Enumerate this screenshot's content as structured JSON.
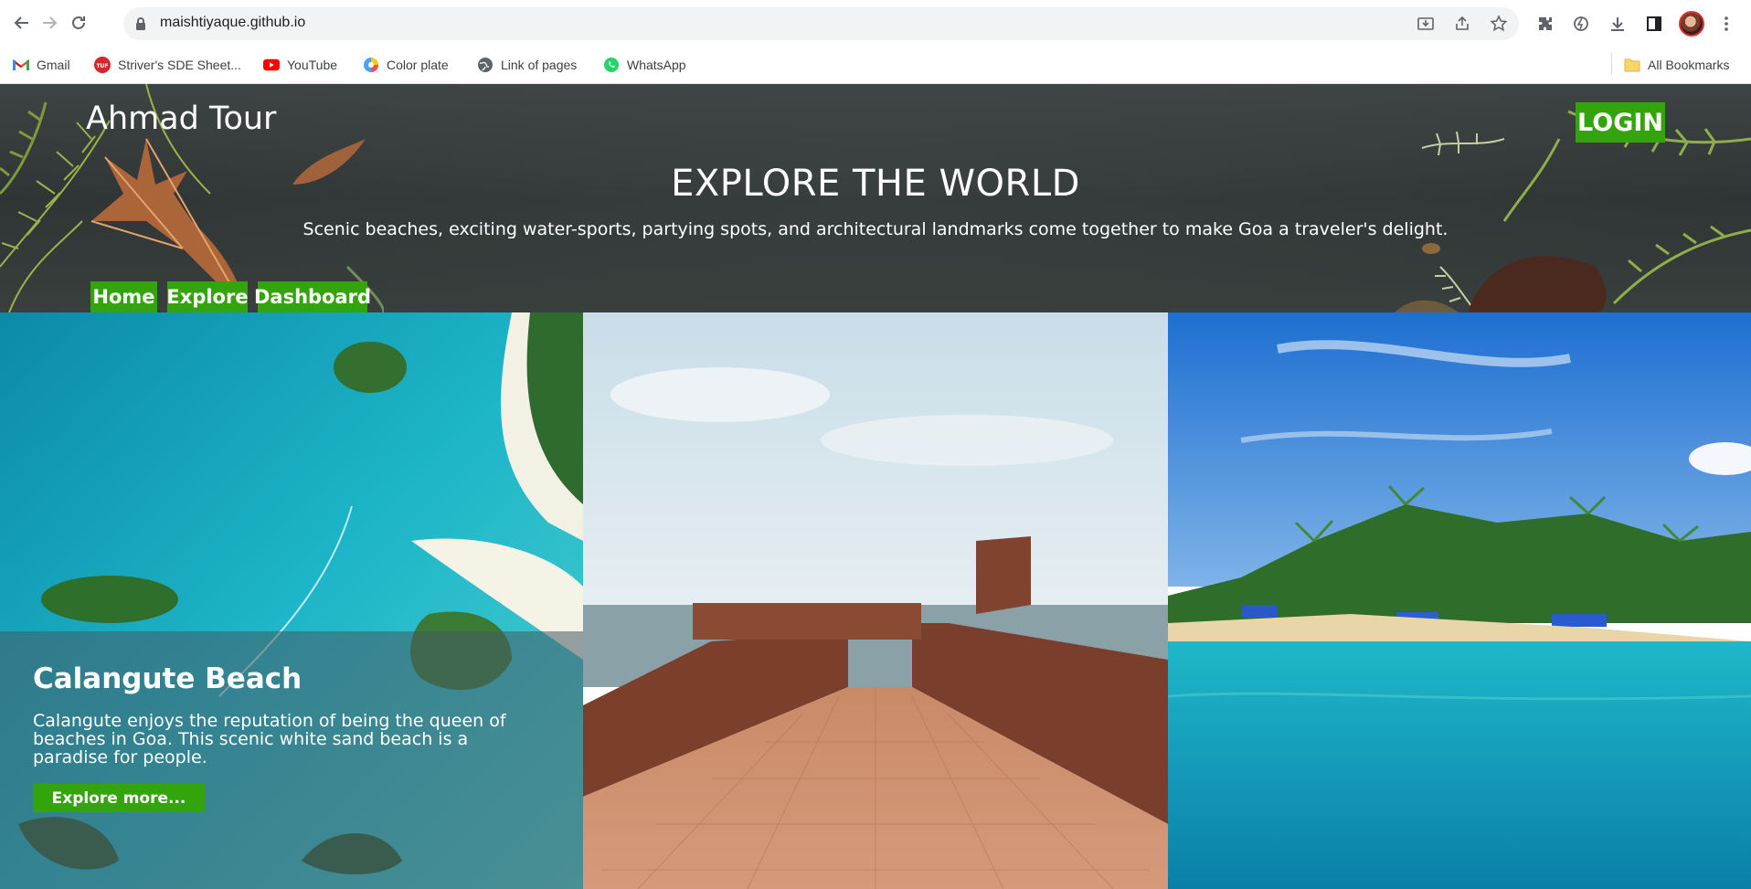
{
  "browser": {
    "url": "maishtiyaque.github.io",
    "bookmarks": [
      {
        "label": "Gmail",
        "icon": "gmail-icon"
      },
      {
        "label": "Striver's SDE Sheet...",
        "icon": "tuf-icon"
      },
      {
        "label": "YouTube",
        "icon": "youtube-icon"
      },
      {
        "label": "Color plate",
        "icon": "color-wheel-icon"
      },
      {
        "label": "Link of pages",
        "icon": "globe-icon"
      },
      {
        "label": "WhatsApp",
        "icon": "whatsapp-icon"
      }
    ],
    "all_bookmarks": "All Bookmarks"
  },
  "site": {
    "brand": "Ahmad Tour",
    "login_label": "LOGIN",
    "hero_title": "EXPLORE THE WORLD",
    "hero_subtitle": "Scenic beaches, exciting water-sports, partying spots, and architectural landmarks come together to make Goa a traveler's delight.",
    "nav": {
      "home": "Home",
      "explore": "Explore",
      "dashboard": "Dashboard"
    },
    "cards": [
      {
        "title": "Calangute Beach",
        "text": "Calangute enjoys the reputation of being the queen of beaches in Goa. This scenic white sand beach is a paradise for people.",
        "button": "Explore more..."
      }
    ],
    "accent": "#34a40c"
  }
}
